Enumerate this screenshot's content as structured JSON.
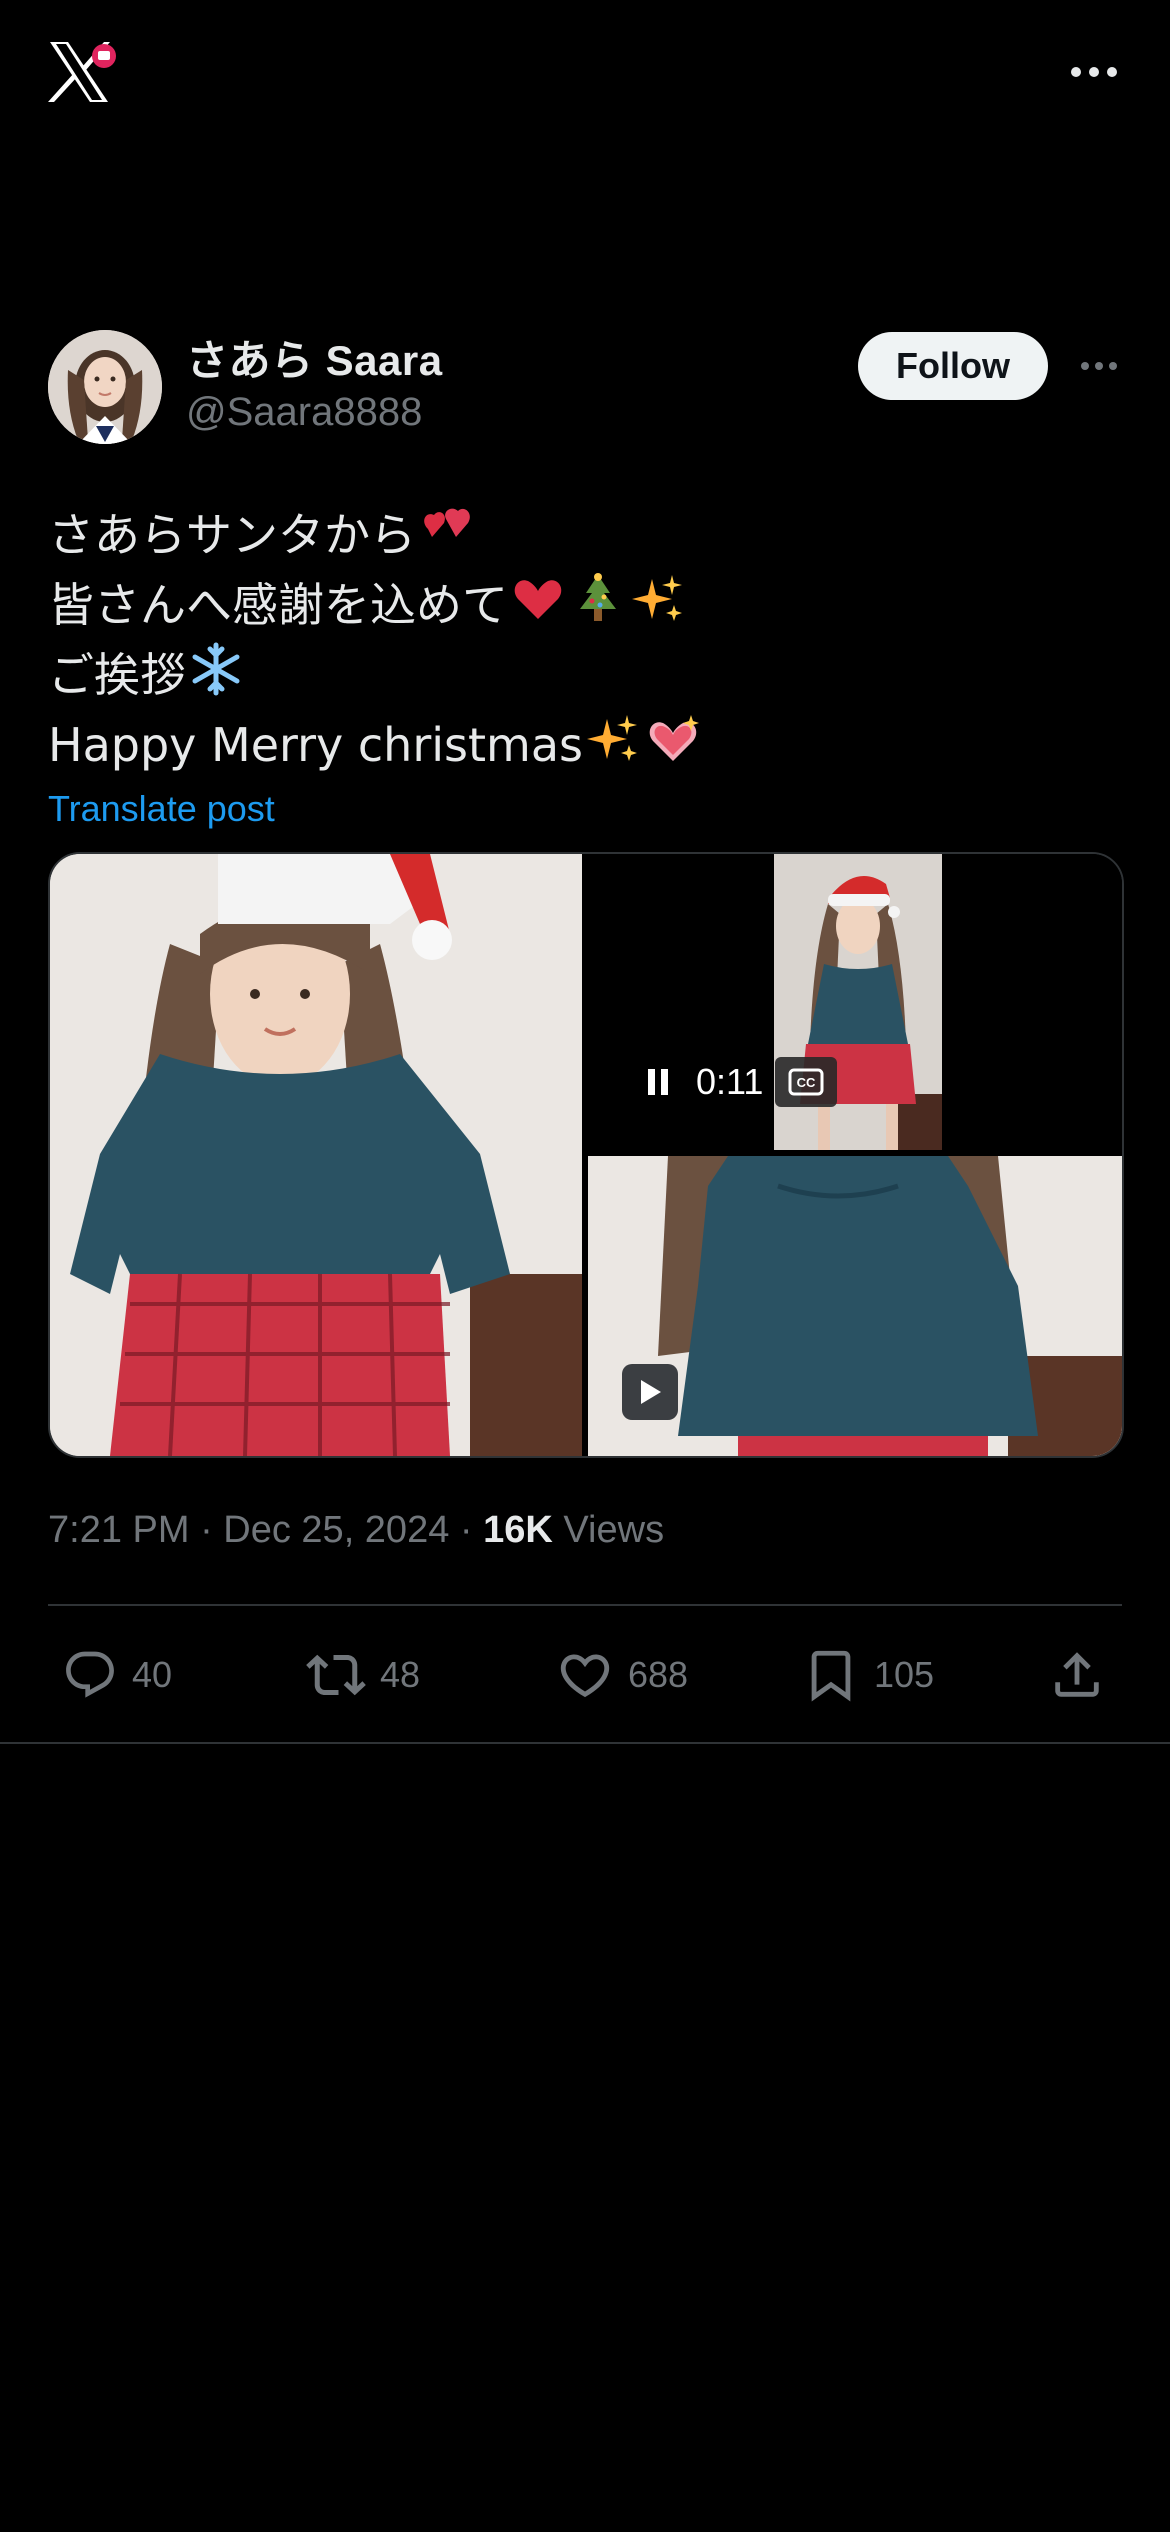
{
  "app": {
    "logo": "x-logo-icon",
    "notification_badge": "red"
  },
  "post": {
    "author": {
      "display_name": "さあら  Saara",
      "handle": "@Saara8888",
      "avatar": "avatar-photo"
    },
    "follow_label": "Follow",
    "text_lines": [
      "さあらサンタから",
      "皆さんへ感謝を込めて",
      "ご挨拶",
      "Happy Merry christmas"
    ],
    "translate_label": "Translate post",
    "media": {
      "video_time": "0:11",
      "cc_label": "CC"
    },
    "timestamp": "7:21 PM · Dec 25, 2024 · ",
    "views_count": "16K",
    "views_label": " Views",
    "stats": {
      "replies": "40",
      "reposts": "48",
      "likes": "688",
      "bookmarks": "105"
    }
  },
  "colors": {
    "background": "#000000",
    "text_primary": "#e7e9ea",
    "text_secondary": "#71767b",
    "link": "#1d9bf0",
    "border": "#2f3336"
  }
}
